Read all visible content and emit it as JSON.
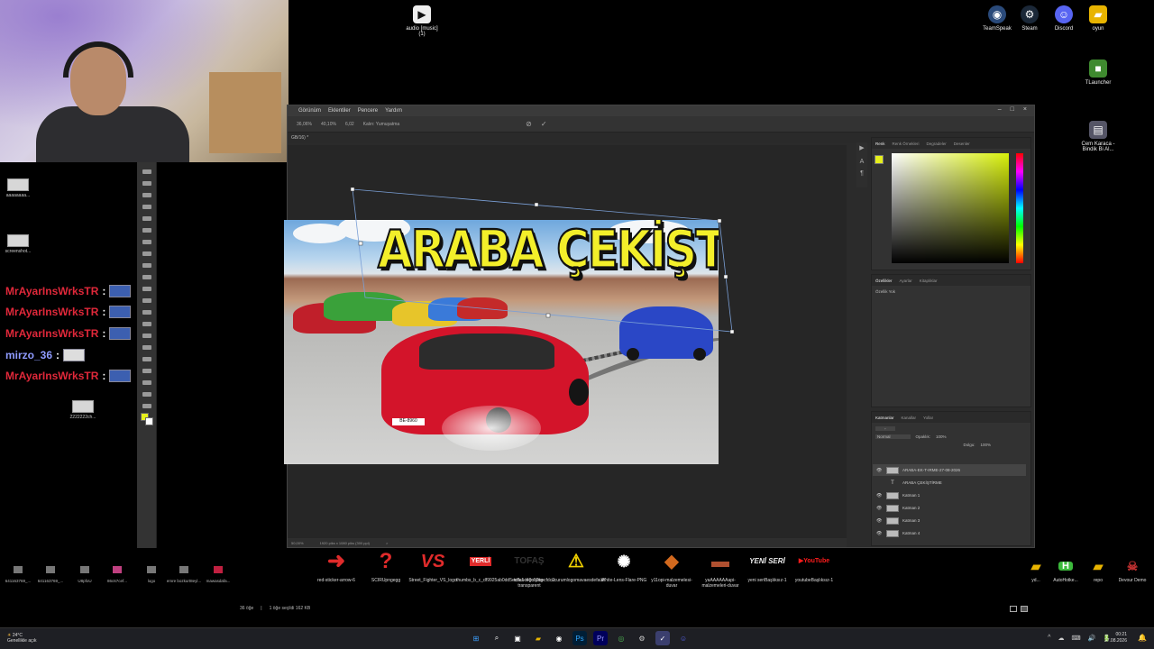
{
  "left_icons": [
    {
      "label": "aaaaaaaa..."
    },
    {
      "label": "screenshot..."
    },
    {
      "label": "2222222ch..."
    }
  ],
  "chat": [
    {
      "user": "MrAyarInsWrksTR",
      "sep": ":"
    },
    {
      "user": "MrAyarInsWrksTR",
      "sep": ":"
    },
    {
      "user": "MrAyarInsWrksTR",
      "sep": ":"
    },
    {
      "user": "mirzo_36",
      "sep": ":"
    },
    {
      "user": "MrAyarInsWrksTR",
      "sep": ":"
    }
  ],
  "desktop_top": {
    "audio": {
      "label": "audio [music] (1)"
    },
    "right": [
      {
        "label": "TeamSpeak",
        "color": "#2a4a7a"
      },
      {
        "label": "Steam",
        "color": "#1b2838"
      },
      {
        "label": "Discord",
        "color": "#5865f2"
      },
      {
        "label": "oyun",
        "color": "#e8b400"
      }
    ],
    "tlauncher": {
      "label": "TLauncher"
    },
    "cem": {
      "label": "Cem Karaca - Bindik Bi Al..."
    }
  },
  "photoshop": {
    "menu": [
      "Görünüm",
      "Eklentiler",
      "Pencere",
      "Yardım"
    ],
    "window_controls": [
      "–",
      "□",
      "×"
    ],
    "options": [
      "36,06%",
      "40,10%",
      "6,02",
      "Kalın: Yumuşatma"
    ],
    "tab": "GB/16) *",
    "status": [
      "50,00%",
      "1920 piks x 1080 piks (300 ppi)",
      ">"
    ]
  },
  "artwork": {
    "title": "ARABA ÇEKİŞTİRME",
    "plate": "BE-8960"
  },
  "color_panel": {
    "tabs": [
      "Renk",
      "Renk Örnekleri",
      "Degradeler",
      "Desenler"
    ],
    "fg": "#e6ef1b"
  },
  "props_panel": {
    "tabs": [
      "Özellikler",
      "Ayarlar",
      "Kitaplıklar"
    ],
    "content": "Özellik Yok"
  },
  "layers_panel": {
    "tabs": [
      "Katmanlar",
      "Kanallar",
      "Yollar"
    ],
    "blend": "Normal",
    "opacity_label": "Opaklık:",
    "opacity": "100%",
    "fill_label": "Dolgu:",
    "fill": "100%",
    "layers": [
      {
        "name": "ARABA-EK-T-IRME-27-08-2026",
        "type": "smart"
      },
      {
        "name": "ARABA ÇEKİŞTİRME",
        "type": "text"
      },
      {
        "name": "Katman 1",
        "type": "img"
      },
      {
        "name": "Katman 2",
        "type": "img"
      },
      {
        "name": "Katman 3",
        "type": "img"
      },
      {
        "name": "Katman 4",
        "type": "img"
      }
    ]
  },
  "bottom_icons": [
    {
      "label": "red-sticker-arrow-6",
      "glyph": "➜",
      "color": "#e02b2b"
    },
    {
      "label": "SCIRUpngegg",
      "glyph": "?",
      "color": "#e02b2b"
    },
    {
      "label": "Street_Fighter_VS_logo",
      "glyph": "VS",
      "color": "#e02b2b"
    },
    {
      "label": "thumbs_b_c_df9925ab0dd5ec8c1c40c52becfdc2",
      "glyph": "YERLİ",
      "color": "#e02b2b"
    },
    {
      "label": "tofas-logo-png-transparent",
      "glyph": "TOFAŞ",
      "color": "#333"
    },
    {
      "label": "ucurumlogomavaesdefault",
      "glyph": "⚠",
      "color": "#f0d000"
    },
    {
      "label": "White-Lens-Flare-PNG",
      "glyph": "✺",
      "color": "#fff"
    },
    {
      "label": "y11opi-malzemelesi-duvar",
      "glyph": "◆",
      "color": "#d2691e"
    },
    {
      "label": "yaAAAAAAapi-malzemeleri-duvar",
      "glyph": "▬",
      "color": "#b05030"
    },
    {
      "label": "yeni seriBaşlıksız-1",
      "glyph": "YENİ SERİ",
      "color": "#eee"
    },
    {
      "label": "youtubeBaşlıksız-1",
      "glyph": "▶YouTube",
      "color": "#ff1c1c"
    }
  ],
  "small_icons": [
    {
      "label": "641163769_..."
    },
    {
      "label": "641163769_..."
    },
    {
      "label": "U8pfoU"
    },
    {
      "label": "86c67cef..."
    },
    {
      "label": "logo"
    },
    {
      "label": "emre bozkurt8eyl..."
    },
    {
      "label": "mawasdafa..."
    }
  ],
  "right_bottom_icons": [
    {
      "label": "yd...",
      "color": "#e8b400"
    },
    {
      "label": "AutoHotke...",
      "color": "#3cba3c"
    },
    {
      "label": "repo",
      "color": "#e8b400"
    },
    {
      "label": "Devour Demo",
      "color": "#7a1a1a"
    }
  ],
  "explorer": {
    "count": "36 öğe",
    "selected": "1 öğe seçildi  162 KB"
  },
  "taskbar": {
    "weather_temp": "24°C",
    "weather_desc": "Genellikle açık",
    "time": "00:21",
    "date": "27.08.2026",
    "tray": [
      "^",
      "☁",
      "⌨",
      "🔊",
      "🔋"
    ]
  }
}
